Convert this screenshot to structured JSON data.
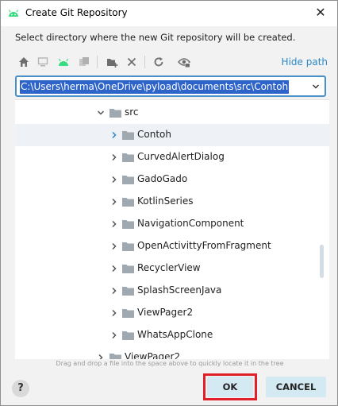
{
  "window": {
    "title": "Create Git Repository",
    "close_symbol": "✕"
  },
  "description": "Select directory where the new Git repository will be created.",
  "toolbar": {
    "icons": [
      "home-icon",
      "desktop-icon",
      "android-project-icon",
      "module-icon",
      "new-folder-icon",
      "delete-icon",
      "refresh-icon",
      "show-hidden-icon"
    ],
    "hide_path_label": "Hide path"
  },
  "path": {
    "value": "C:\\Users\\herma\\OneDrive\\pyload\\documents\\src\\Contoh"
  },
  "tree": {
    "parent": {
      "label": "src",
      "expanded": true
    },
    "items": [
      {
        "label": "Contoh",
        "selected": true
      },
      {
        "label": "CurvedAlertDialog"
      },
      {
        "label": "GadoGado"
      },
      {
        "label": "KotlinSeries"
      },
      {
        "label": "NavigationComponent"
      },
      {
        "label": "OpenActivittyFromFragment"
      },
      {
        "label": "RecyclerView"
      },
      {
        "label": "SplashScreenJava"
      },
      {
        "label": "ViewPager2"
      },
      {
        "label": "WhatsAppClone"
      }
    ],
    "next_sibling": {
      "label": "ViewPager2"
    }
  },
  "hint": "Drag and drop a file into the space above to quickly locate it in the tree",
  "buttons": {
    "help": "?",
    "ok": "OK",
    "cancel": "CANCEL"
  },
  "colors": {
    "accent": "#2e64c9",
    "link": "#2a88c8",
    "button_bg": "#d4eaf3",
    "highlight_outline": "#e0202a",
    "android_green": "#3ddc84"
  }
}
